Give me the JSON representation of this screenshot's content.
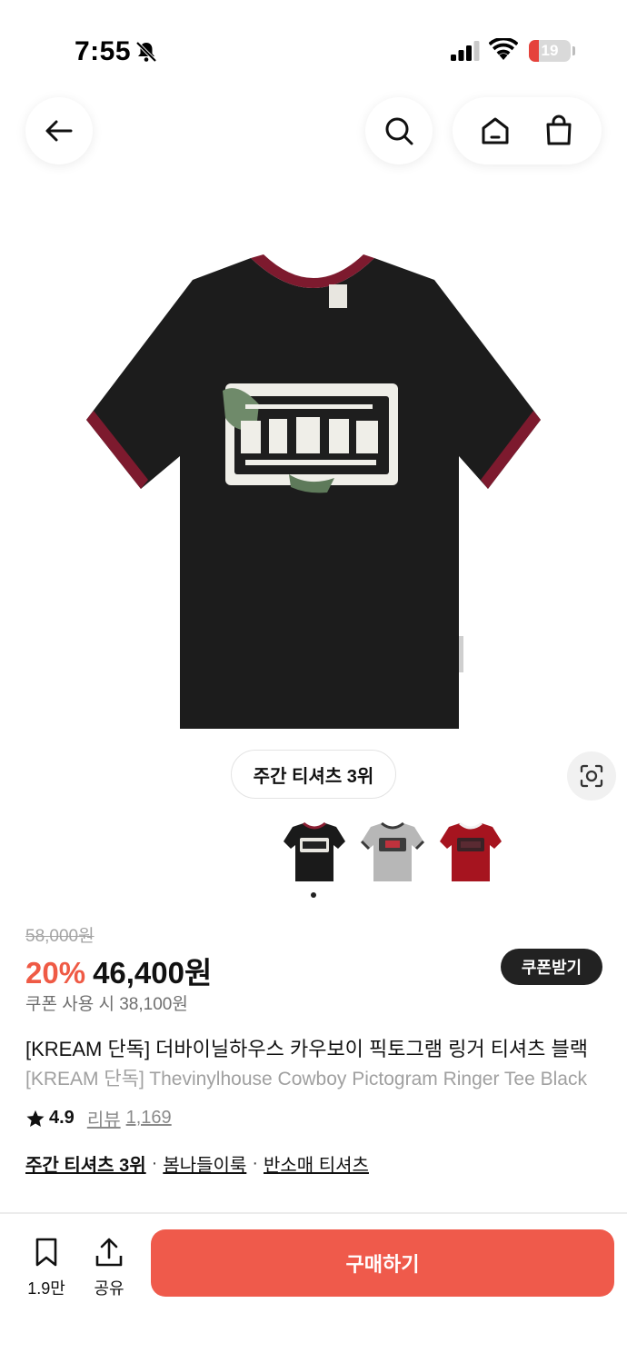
{
  "status_bar": {
    "time": "7:55",
    "battery": "19",
    "battery_color": "#e5423b"
  },
  "nav": {
    "back_icon": "arrow-left-icon",
    "search_icon": "search-icon",
    "home_icon": "home-icon",
    "cart_icon": "shopping-bag-icon"
  },
  "gallery": {
    "rank_chip": "주간 티셔츠 3위",
    "lens_icon": "visual-search-icon",
    "thumbnails": [
      {
        "color": "black",
        "trim": "#8b1f33"
      },
      {
        "color": "gray",
        "trim": "#3a3a3a"
      },
      {
        "color": "red",
        "trim": "#6b0f18"
      }
    ],
    "current_index": 1
  },
  "product": {
    "original_price": "58,000원",
    "discount": "20%",
    "price": "46,400원",
    "coupon_button": "쿠폰받기",
    "coupon_price_text": "쿠폰 사용 시 38,100원",
    "title_ko": "[KREAM 단독] 더바이닐하우스 카우보이 픽토그램 링거 티셔츠 블랙",
    "title_en": "[KREAM 단독] Thevinylhouse Cowboy Pictogram Ringer Tee Black",
    "rating": "4.9",
    "review_label": "리뷰",
    "review_count": "1,169",
    "tags": [
      "주간 티셔츠 3위",
      "봄나들이룩",
      "반소매 티셔츠"
    ]
  },
  "bottom_bar": {
    "bookmark_count": "1.9만",
    "share_label": "공유",
    "buy_label": "구매하기",
    "accent": "#ef5a4b"
  }
}
